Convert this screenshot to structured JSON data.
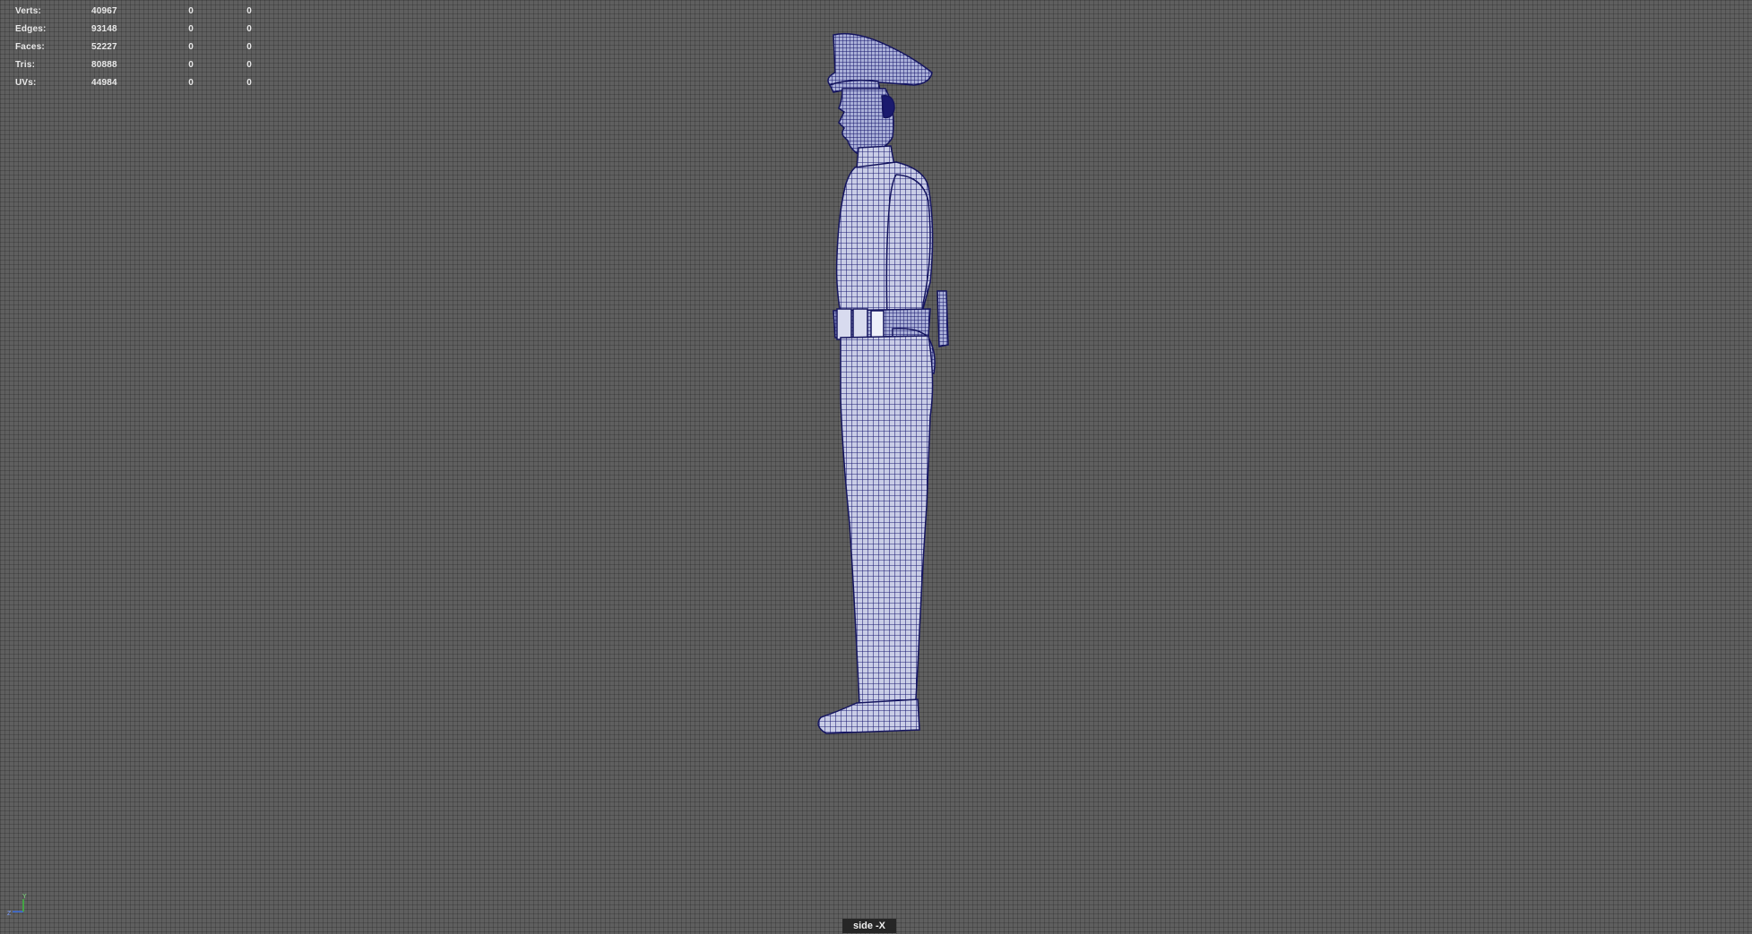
{
  "hud": {
    "rows": [
      {
        "label": "Verts:",
        "a": "40967",
        "b": "0",
        "c": "0"
      },
      {
        "label": "Edges:",
        "a": "93148",
        "b": "0",
        "c": "0"
      },
      {
        "label": "Faces:",
        "a": "52227",
        "b": "0",
        "c": "0"
      },
      {
        "label": "Tris:",
        "a": "80888",
        "b": "0",
        "c": "0"
      },
      {
        "label": "UVs:",
        "a": "44984",
        "b": "0",
        "c": "0"
      }
    ]
  },
  "viewport": {
    "camera_label": "side -X",
    "background_color": "#5f5f5f",
    "wireframe_color": "#1a1a6e"
  },
  "axis": {
    "y_label": "Y",
    "z_label": "Z"
  },
  "icons": {
    "model": "police-officer-wireframe-model",
    "axis": "view-axis-gizmo-icon"
  }
}
